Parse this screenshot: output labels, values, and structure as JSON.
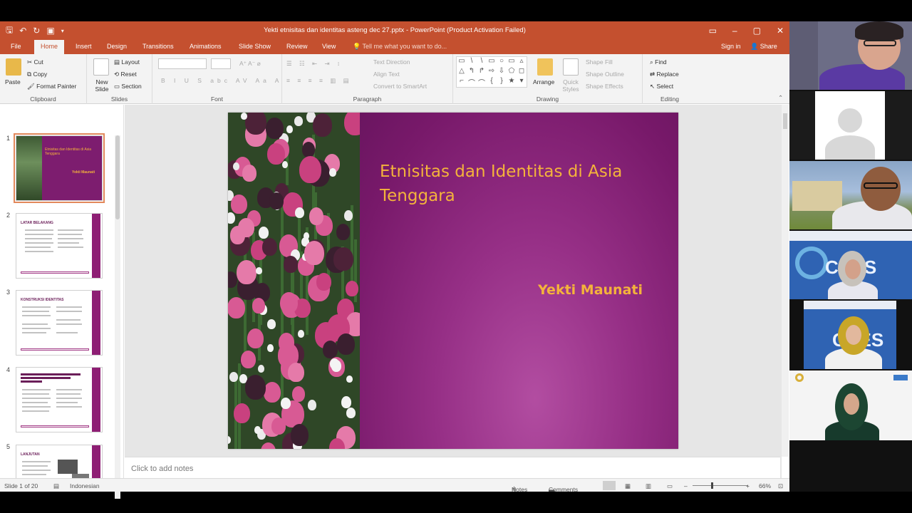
{
  "window": {
    "title": "Yekti etnisitas dan identitas asteng dec 27.pptx - PowerPoint (Product Activation Failed)",
    "controls": [
      "restore-ribbon",
      "minimize",
      "maximize",
      "close"
    ]
  },
  "ribbon_tabs": [
    "File",
    "Home",
    "Insert",
    "Design",
    "Transitions",
    "Animations",
    "Slide Show",
    "Review",
    "View"
  ],
  "active_tab": "Home",
  "tell_me": "Tell me what you want to do...",
  "sign_in": "Sign in",
  "share": "Share",
  "clipboard": {
    "paste": "Paste",
    "cut": "Cut",
    "copy": "Copy",
    "format_painter": "Format Painter",
    "label": "Clipboard"
  },
  "slides_group": {
    "new_slide": "New Slide",
    "layout": "Layout",
    "reset": "Reset",
    "section": "Section",
    "label": "Slides"
  },
  "font_group": {
    "label": "Font"
  },
  "paragraph_group": {
    "text_direction": "Text Direction",
    "align_text": "Align Text",
    "convert_smartart": "Convert to SmartArt",
    "label": "Paragraph"
  },
  "drawing_group": {
    "arrange": "Arrange",
    "quick_styles": "Quick Styles",
    "shape_fill": "Shape Fill",
    "shape_outline": "Shape Outline",
    "shape_effects": "Shape Effects",
    "label": "Drawing"
  },
  "editing_group": {
    "find": "Find",
    "replace": "Replace",
    "select": "Select",
    "label": "Editing"
  },
  "thumbnails": [
    {
      "number": "1",
      "heading": "Etnisitas dan Identitas di Asia Tenggara"
    },
    {
      "number": "2",
      "heading": "LATAR BELAKANG"
    },
    {
      "number": "3",
      "heading": "KONSTRUKSI IDENTITAS"
    },
    {
      "number": "4",
      "heading": ""
    },
    {
      "number": "5",
      "heading": "LANJUTAN"
    }
  ],
  "slide": {
    "title": "Etnisitas dan Identitas di Asia Tenggara",
    "author": "Yekti Maunati"
  },
  "notes_placeholder": "Click to add notes",
  "status": {
    "slide_info": "Slide 1 of 20",
    "language": "Indonesian",
    "notes": "Notes",
    "comments": "Comments",
    "zoom": "66%"
  },
  "video_tiles": [
    "participant-1",
    "participant-2",
    "participant-3",
    "participant-4",
    "participant-5",
    "participant-6"
  ]
}
